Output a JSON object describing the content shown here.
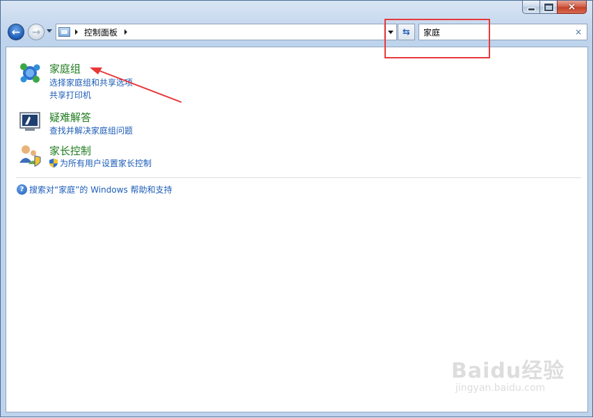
{
  "window": {
    "caption_buttons": {
      "minimize_icon": "minimize-icon",
      "maximize_icon": "maximize-icon",
      "close_glyph": "×"
    }
  },
  "nav": {
    "back_icon": "back-arrow-icon",
    "forward_icon": "forward-arrow-icon",
    "breadcrumb": [
      "控制面板"
    ],
    "refresh_icon": "refresh-icon"
  },
  "search": {
    "value": "家庭",
    "clear_glyph": "×"
  },
  "results": [
    {
      "icon": "homegroup-icon",
      "title": "家庭组",
      "links": [
        "选择家庭组和共享选项",
        "共享打印机"
      ]
    },
    {
      "icon": "troubleshooting-icon",
      "title": "疑难解答",
      "links": [
        "查找并解决家庭组问题"
      ]
    },
    {
      "icon": "parental-controls-icon",
      "title": "家长控制",
      "links": [
        "为所有用户设置家长控制"
      ],
      "link_icon": "uac-shield-icon"
    }
  ],
  "help": {
    "icon": "help-icon",
    "glyph": "?",
    "text": "搜索对“家庭”的 Windows 帮助和支持"
  },
  "watermark": {
    "logo": "Baidu经验",
    "url": "jingyan.baidu.com"
  },
  "colors": {
    "title_green": "#1e7b1e",
    "link_blue": "#1c5cb8",
    "annotation_red": "#e8383a"
  }
}
